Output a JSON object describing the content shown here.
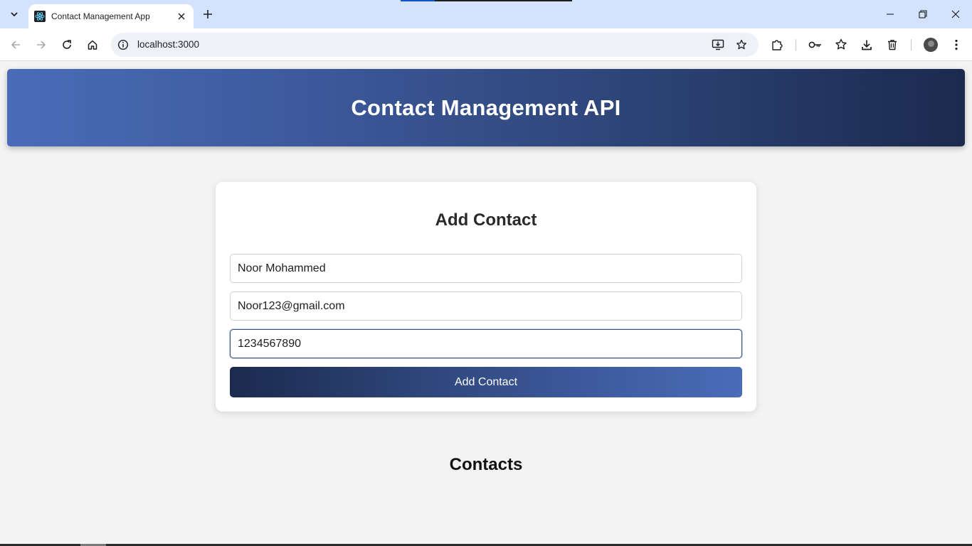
{
  "browser": {
    "tab_title": "Contact Management App",
    "url": "localhost:3000",
    "icons": {
      "tab_search": "chevron-down-icon",
      "favicon": "react-icon",
      "tab_close": "close-icon",
      "new_tab": "plus-icon",
      "back": "arrow-left-icon",
      "forward": "arrow-right-icon",
      "reload": "reload-icon",
      "home": "home-icon",
      "site_info": "info-icon",
      "install": "install-app-icon",
      "bookmark": "star-icon",
      "extensions": "puzzle-icon",
      "passwords": "key-icon",
      "bookmarks_manager": "star-list-icon",
      "downloads": "download-icon",
      "trash": "trash-icon",
      "menu": "more-vertical-icon"
    }
  },
  "header": {
    "title": "Contact Management API"
  },
  "form": {
    "title": "Add Contact",
    "name_value": "Noor Mohammed",
    "email_value": "Noor123@gmail.com",
    "phone_value": "1234567890",
    "submit_label": "Add Contact"
  },
  "contacts": {
    "title": "Contacts"
  },
  "colors": {
    "header_gradient_start": "#4a6cb8",
    "header_gradient_end": "#1b2a4e",
    "page_background": "#f3f3f3",
    "tabbar_background": "#d3e3fd"
  }
}
